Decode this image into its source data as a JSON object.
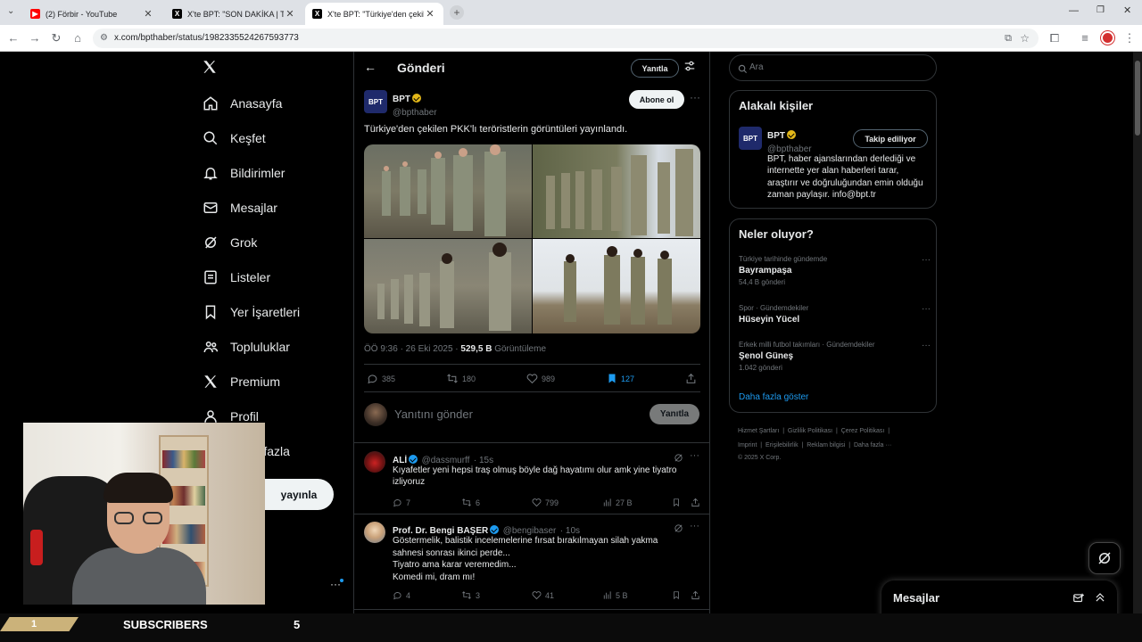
{
  "browser": {
    "tabs": [
      {
        "title": "(2) Förbir - YouTube",
        "favicon": "youtube-icon"
      },
      {
        "title": "X'te BPT: \"SON DAKİKA | Terör ö",
        "favicon": "x-icon"
      },
      {
        "title": "X'te BPT: \"Türkiye'den çekilen P",
        "favicon": "x-icon"
      }
    ],
    "url": "x.com/bpthaber/status/1982335524267593773"
  },
  "sidebar": {
    "items": [
      {
        "label": "Anasayfa",
        "icon": "home-icon"
      },
      {
        "label": "Keşfet",
        "icon": "search-icon"
      },
      {
        "label": "Bildirimler",
        "icon": "bell-icon"
      },
      {
        "label": "Mesajlar",
        "icon": "envelope-icon"
      },
      {
        "label": "Grok",
        "icon": "grok-icon"
      },
      {
        "label": "Listeler",
        "icon": "list-icon"
      },
      {
        "label": "Yer İşaretleri",
        "icon": "bookmark-icon"
      },
      {
        "label": "Topluluklar",
        "icon": "communities-icon"
      },
      {
        "label": "Premium",
        "icon": "x-icon"
      },
      {
        "label": "Profil",
        "icon": "person-icon"
      },
      {
        "label": "Daha fazla",
        "icon": "more-circle-icon"
      }
    ],
    "post_button": "yayınla"
  },
  "header": {
    "title": "Gönderi",
    "reply_label": "Yanıtla"
  },
  "post": {
    "author_name": "BPT",
    "author_handle": "@bpthaber",
    "follow_label": "Abone ol",
    "text": "Türkiye'den çekilen PKK'lı teröristlerin görüntüleri yayınlandı.",
    "time": "ÖÖ 9:36 · 26 Eki 2025 · ",
    "views_count": "529,5 B",
    "views_label": " Görüntüleme",
    "replies": "385",
    "retweets": "180",
    "likes": "989",
    "bookmarks": "127"
  },
  "reply_box": {
    "placeholder": "Yanıtını gönder",
    "button": "Yanıtla"
  },
  "replies": [
    {
      "name": "ALİ",
      "handle": "@dassmurff",
      "time": "· 15s",
      "lines": [
        "Kıyafetler yeni hepsi traş olmuş böyle dağ hayatımı olur amk yine tiyatro",
        "izliyoruz"
      ],
      "replies": "7",
      "retweets": "6",
      "likes": "799",
      "views": "27 B"
    },
    {
      "name": "Prof. Dr. Bengi BAŞER",
      "handle": "@bengibaser",
      "time": "· 10s",
      "lines": [
        "Göstermelik, balistik incelemelerine fırsat bırakılmayan silah yakma",
        "sahnesi sonrası ikinci perde...",
        "Tiyatro ama karar veremedim...",
        "Komedi mi, dram mı!"
      ],
      "replies": "4",
      "retweets": "3",
      "likes": "41",
      "views": "5 B"
    }
  ],
  "search": {
    "placeholder": "Ara"
  },
  "related": {
    "title": "Alakalı kişiler",
    "name": "BPT",
    "handle": "@bpthaber",
    "button": "Takip ediliyor",
    "bio": [
      "BPT, haber ajanslarından derlediği ve",
      "internette yer alan haberleri tarar,",
      "araştırır ve doğruluğundan emin olduğu",
      "zaman paylaşır. info@bpt.tr"
    ]
  },
  "trends": {
    "title": "Neler oluyor?",
    "items": [
      {
        "meta": "Türkiye tarihinde gündemde",
        "title": "Bayrampaşa",
        "count": "54,4 B gönderi"
      },
      {
        "meta": "Spor · Gündemdekiler",
        "title": "Hüseyin Yücel",
        "count": ""
      },
      {
        "meta": "Erkek milli futbol takımları · Gündemdekiler",
        "title": "Şenol Güneş",
        "count": "1.042 gönderi"
      }
    ],
    "show_more": "Daha fazla göster"
  },
  "footer": {
    "links_row1": [
      "Hizmet Şartları",
      "|",
      "Gizlilik Politikası",
      "|",
      "Çerez Politikası",
      "|"
    ],
    "links_row2": [
      "Imprint",
      "|",
      "Erişilebilirlik",
      "|",
      "Reklam bilgisi",
      "|",
      "Daha fazla ···"
    ],
    "copyright": "© 2025 X Corp."
  },
  "messages_dock": {
    "title": "Mesajlar"
  },
  "overlay": {
    "rank": "1",
    "label": "SUBSCRIBERS",
    "count": "5"
  },
  "colors": {
    "accent": "#1d9bf0",
    "gold": "#e2b719",
    "background": "#000000"
  }
}
